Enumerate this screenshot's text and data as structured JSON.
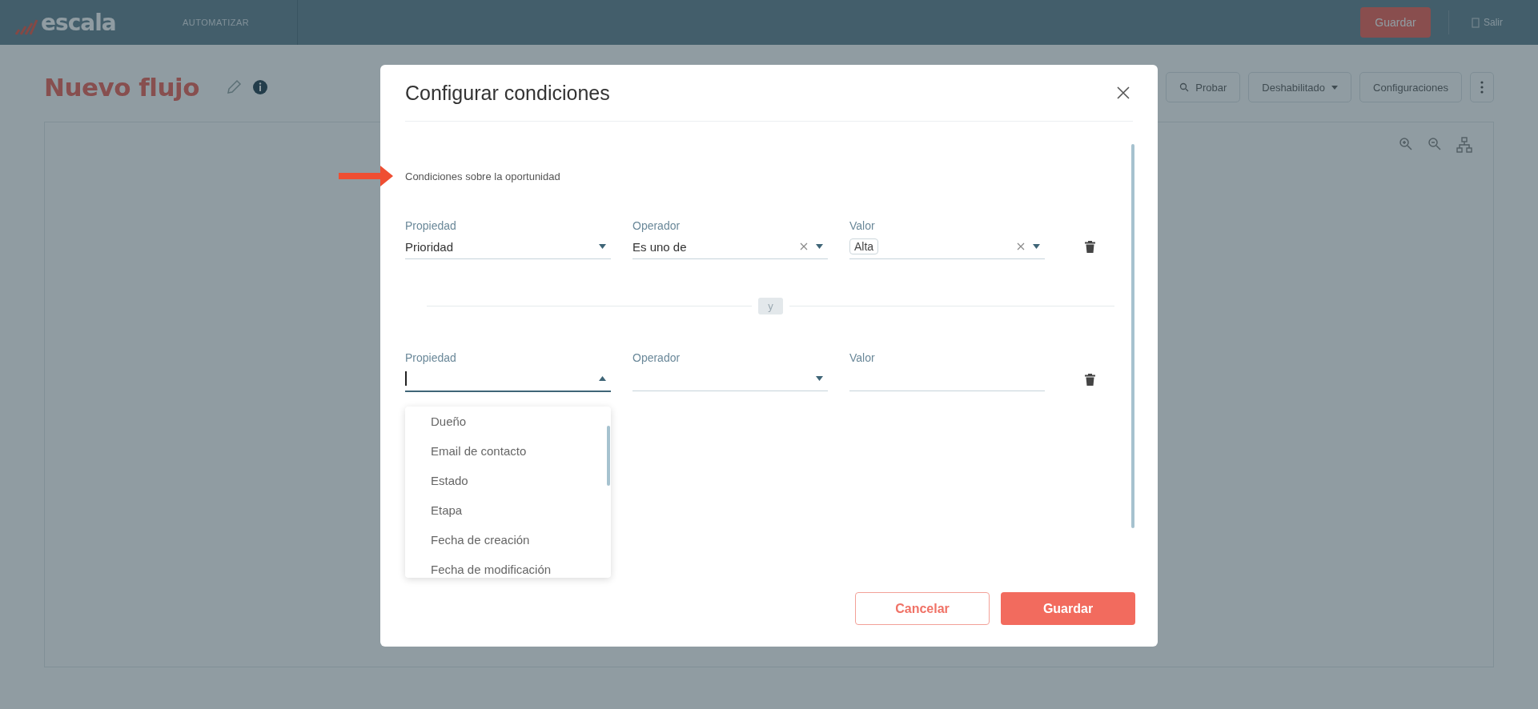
{
  "topbar": {
    "logo": "escala",
    "section": "AUTOMATIZAR",
    "save_button": "Guardar",
    "exit_button": "Salir"
  },
  "page": {
    "title": "Nuevo flujo",
    "toolbar": [
      {
        "label": "Probar",
        "kind": "icon"
      },
      {
        "label": "Deshabilitado",
        "kind": "dropdown"
      },
      {
        "label": "Configuraciones",
        "kind": "plain"
      }
    ]
  },
  "modal": {
    "title": "Configurar condiciones",
    "section_label": "Condiciones sobre la oportunidad",
    "connector": "y",
    "conditions": [
      {
        "fields": [
          {
            "label": "Propiedad",
            "kind": "select",
            "value": "Prioridad",
            "clearable": false,
            "open": false
          },
          {
            "label": "Operador",
            "kind": "select",
            "value": "Es uno de",
            "clearable": true,
            "open": false
          },
          {
            "label": "Valor",
            "kind": "select",
            "chips": [
              "Alta"
            ],
            "clearable": true,
            "open": false
          }
        ]
      },
      {
        "fields": [
          {
            "label": "Propiedad",
            "kind": "select",
            "clearable": false,
            "open": true,
            "options": [
              "Dueño",
              "Email de contacto",
              "Estado",
              "Etapa",
              "Fecha de creación",
              "Fecha de modificación"
            ]
          },
          {
            "label": "Operador",
            "kind": "select",
            "clearable": false,
            "open": false
          },
          {
            "label": "Valor",
            "kind": "text",
            "clearable": false,
            "open": false
          }
        ]
      }
    ],
    "buttons": {
      "cancel": "Cancelar",
      "save": "Guardar"
    }
  }
}
